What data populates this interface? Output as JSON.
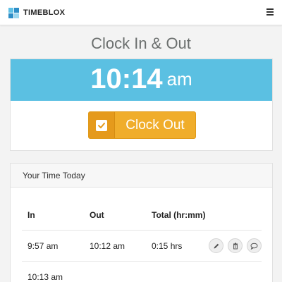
{
  "app": {
    "brand": "TIMEBLOX"
  },
  "page": {
    "title": "Clock In & Out"
  },
  "clock": {
    "time": "10:14",
    "ampm": "am",
    "button_label": "Clock Out",
    "bar_color": "#5bc0e2",
    "button_color": "#f0ad2b"
  },
  "today": {
    "heading": "Your Time Today",
    "columns": [
      "In",
      "Out",
      "Total (hr:mm)"
    ],
    "rows": [
      {
        "in": "9:57 am",
        "out": "10:12 am",
        "total": "0:15 hrs"
      },
      {
        "in": "10:13 am",
        "out": "",
        "total": ""
      }
    ]
  },
  "icons": {
    "menu": "hamburger-menu-icon",
    "clock_button": "checkbox-icon",
    "row_actions": [
      "pencil-icon",
      "trash-icon",
      "comment-icon"
    ]
  }
}
